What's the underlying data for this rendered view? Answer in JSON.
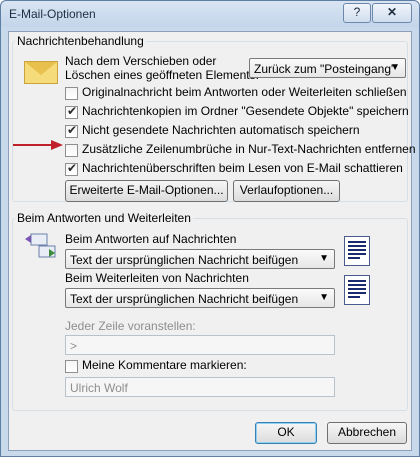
{
  "window": {
    "title": "E-Mail-Optionen",
    "help_label": "?",
    "close_label": "✕"
  },
  "message_handling": {
    "label": "Nachrichtenbehandlung",
    "after_move_line1": "Nach dem Verschieben oder",
    "after_move_line2": "Löschen eines geöffneten Elements:",
    "after_move_value": "Zurück zum \"Posteingang\"",
    "options": [
      {
        "label": "Originalnachricht beim Antworten oder Weiterleiten schließen",
        "checked": false
      },
      {
        "label": "Nachrichtenkopien im Ordner \"Gesendete Objekte\" speichern",
        "checked": true
      },
      {
        "label": "Nicht gesendete Nachrichten automatisch speichern",
        "checked": true
      },
      {
        "label": "Zusätzliche Zeilenumbrüche in Nur-Text-Nachrichten entfernen",
        "checked": false
      },
      {
        "label": "Nachrichtenüberschriften beim Lesen von E-Mail schattieren",
        "checked": true
      }
    ],
    "advanced_button": "Erweiterte E-Mail-Optionen...",
    "tracking_button": "Verlaufoptionen..."
  },
  "reply_forward": {
    "label": "Beim Antworten und Weiterleiten",
    "reply_label": "Beim Antworten auf Nachrichten",
    "reply_value": "Text der ursprünglichen Nachricht beifügen",
    "forward_label": "Beim Weiterleiten von Nachrichten",
    "forward_value": "Text der ursprünglichen Nachricht beifügen",
    "prefix_label": "Jeder Zeile voranstellen:",
    "prefix_value": ">",
    "mark_comments_label": "Meine Kommentare markieren:",
    "mark_comments_checked": false,
    "comment_name": "Ulrich Wolf"
  },
  "footer": {
    "ok_label": "OK",
    "cancel_label": "Abbrechen"
  },
  "colors": {
    "arrow": "#c0202a",
    "default_button_border": "#3c7fb1"
  }
}
